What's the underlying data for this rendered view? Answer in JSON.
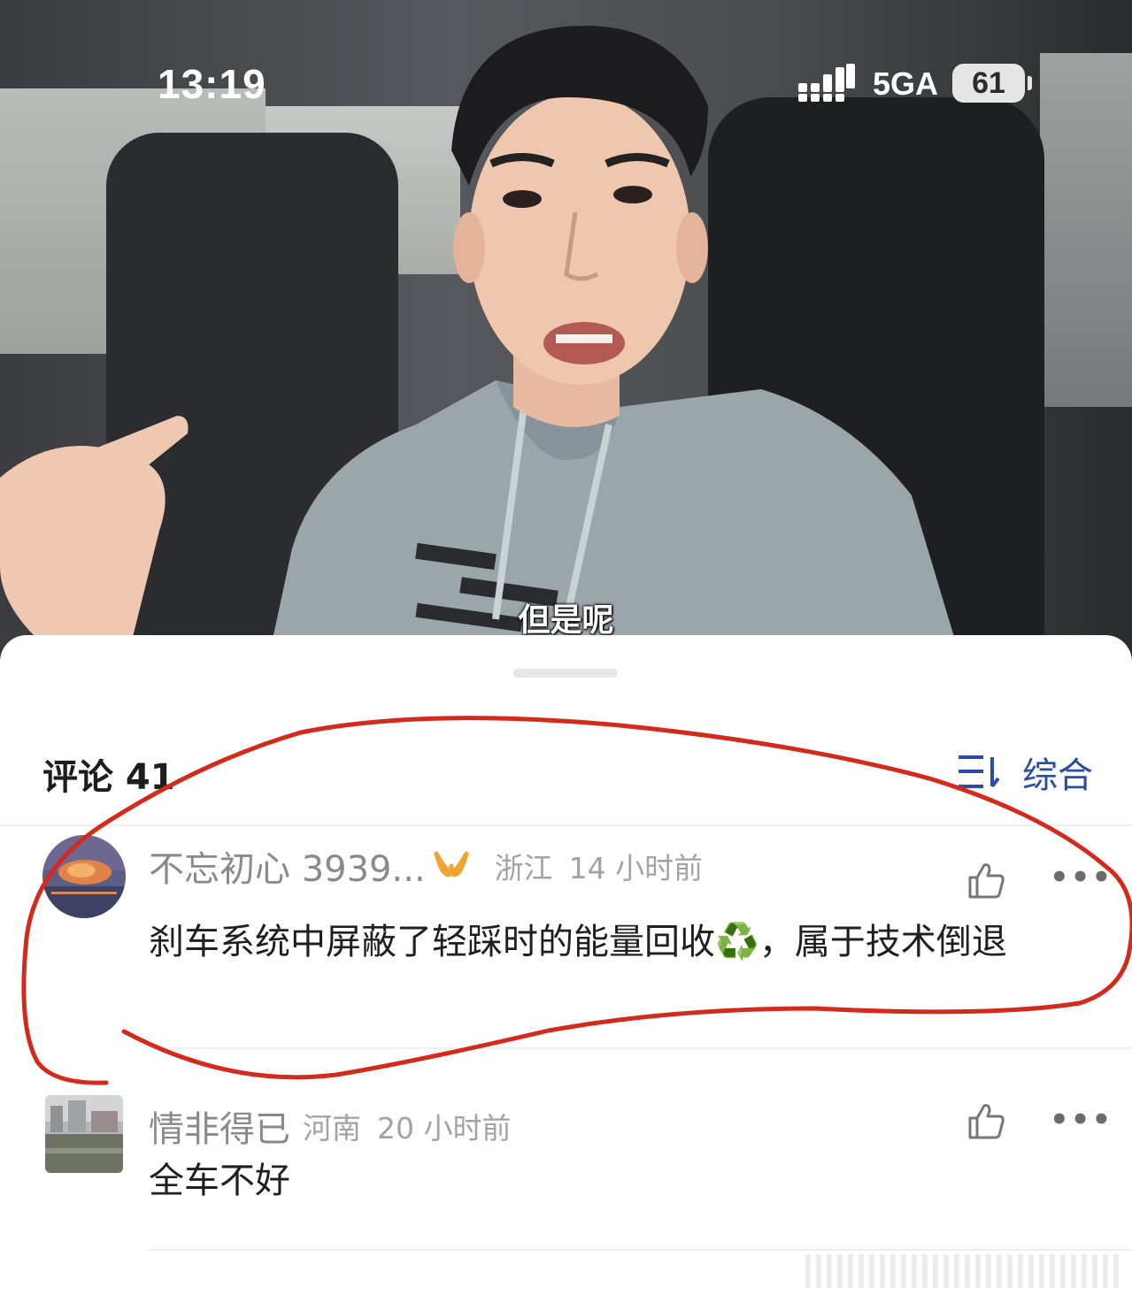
{
  "status_bar": {
    "time": "13:19",
    "network": "5GA",
    "battery": "61"
  },
  "video": {
    "subtitle": "但是呢"
  },
  "comments_panel": {
    "title": "评论 41",
    "sort_label": "综合",
    "comments": [
      {
        "username": "不忘初心 3939...",
        "location": "浙江",
        "time": "14 小时前",
        "text": "刹车系统中屏蔽了轻踩时的能量回收♻️，属于技术倒退"
      },
      {
        "username": "情非得已",
        "location": "河南",
        "time": "20 小时前",
        "text": "全车不好"
      }
    ]
  },
  "colors": {
    "accent_blue": "#2b4da6",
    "annotation_red": "#d42a1c"
  }
}
